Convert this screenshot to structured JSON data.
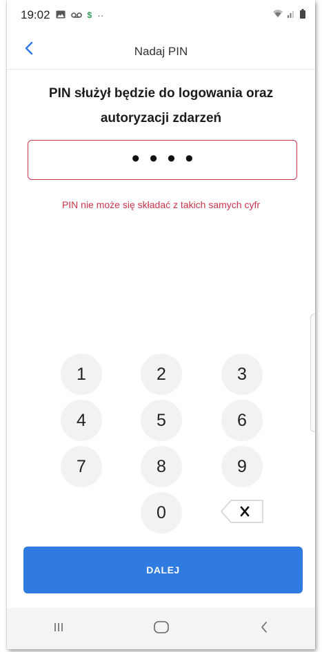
{
  "status_bar": {
    "time": "19:02",
    "icons": [
      "image-icon",
      "voicemail-icon",
      "dollar-icon",
      "more-dots-icon",
      "wifi-icon",
      "signal-icon",
      "battery-icon"
    ]
  },
  "header": {
    "title": "Nadaj PIN",
    "back_icon": "chevron-left-icon"
  },
  "main": {
    "headline": "PIN służył będzie do logowania oraz autoryzacji zdarzeń",
    "pin_masked": "••••",
    "error": "PIN nie może się składać z takich samych cyfr"
  },
  "keypad": {
    "keys": [
      "1",
      "2",
      "3",
      "4",
      "5",
      "6",
      "7",
      "8",
      "9",
      "0"
    ],
    "backspace_icon": "backspace-icon"
  },
  "actions": {
    "next_label": "DALEJ"
  },
  "nav_bar": {
    "buttons": [
      "recents-icon",
      "home-icon",
      "back-icon"
    ]
  },
  "colors": {
    "accent": "#2f7be0",
    "error": "#c9334a",
    "key_bg": "#f2f2f2"
  }
}
